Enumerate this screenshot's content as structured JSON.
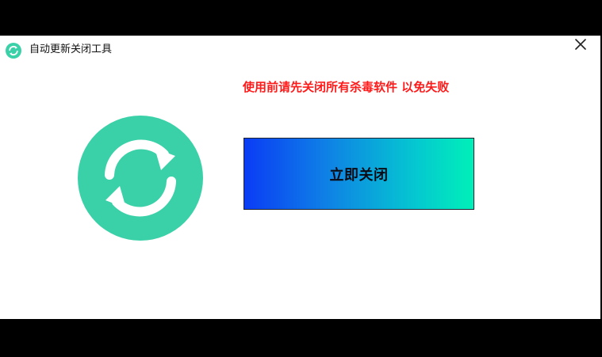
{
  "window": {
    "title": "自动更新关闭工具",
    "app_icon": "refresh-icon",
    "close_icon": "close-icon"
  },
  "main": {
    "warning_text": "使用前请先关闭所有杀毒软件 以免失败",
    "action_button_label": "立即关闭",
    "hero_icon": "refresh-icon"
  },
  "colors": {
    "accent": "#3ad1a8",
    "warning": "#ff1a1a",
    "button_gradient_start": "#0a3cf5",
    "button_gradient_end": "#00f0b8",
    "outer_background": "#000000"
  }
}
